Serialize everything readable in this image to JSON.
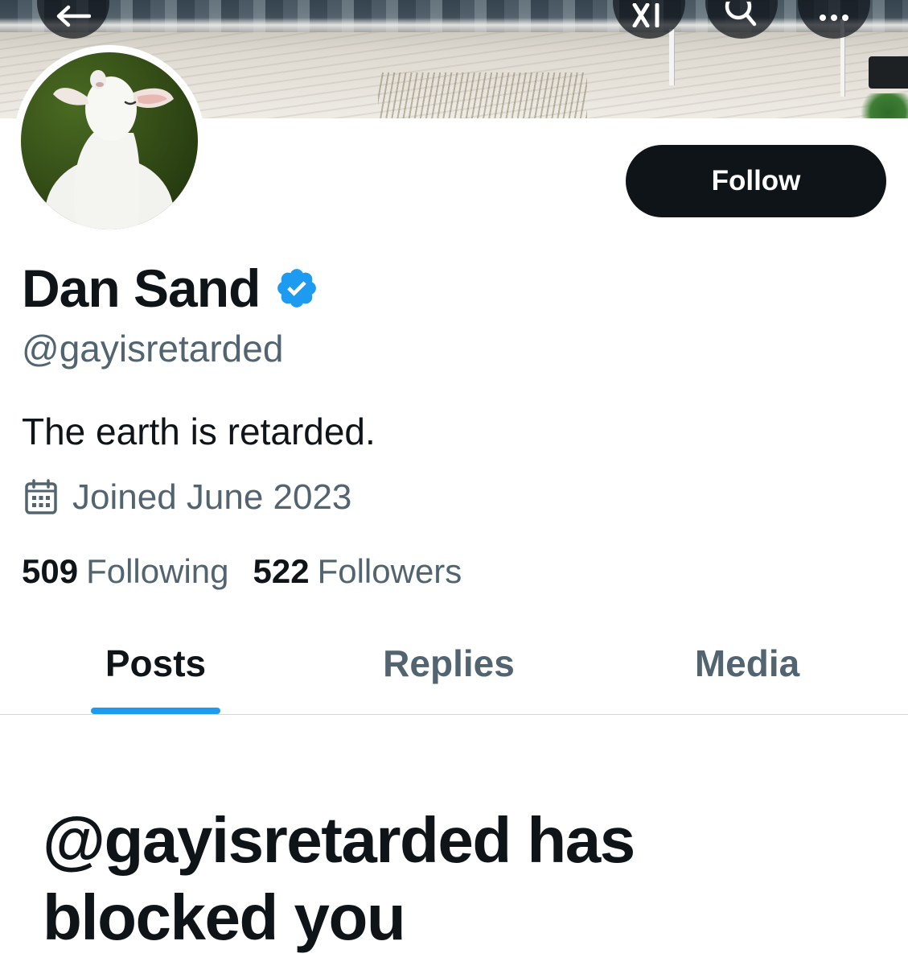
{
  "header": {
    "back_icon": "arrow-left-icon",
    "grok_icon": "grok-icon",
    "search_icon": "search-icon",
    "more_icon": "more-horizontal-icon"
  },
  "profile": {
    "name": "Dan Sand",
    "handle": "@gayisretarded",
    "bio": "The earth is retarded.",
    "joined": "Joined June 2023",
    "following_count": "509",
    "following_label": "Following",
    "followers_count": "522",
    "followers_label": "Followers",
    "verified": true
  },
  "actions": {
    "follow_label": "Follow"
  },
  "tabs": [
    {
      "label": "Posts",
      "active": true
    },
    {
      "label": "Replies",
      "active": false
    },
    {
      "label": "Media",
      "active": false
    }
  ],
  "blocked_message": "@gayisretarded has blocked you",
  "colors": {
    "accent": "#1d9bf0",
    "text_primary": "#0f1419",
    "text_secondary": "#536471",
    "button_bg": "#0f1419"
  }
}
